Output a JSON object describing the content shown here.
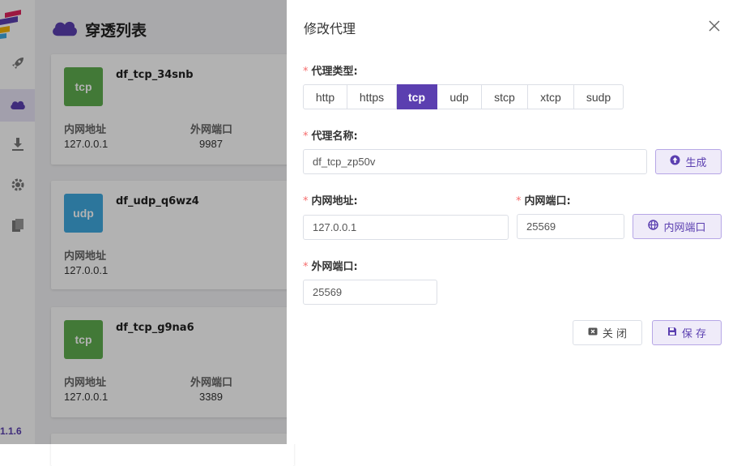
{
  "app": {
    "version": "1.1.6",
    "list_title": "穿透列表",
    "cards": [
      {
        "type": "tcp",
        "name": "df_tcp_34snb",
        "lan_label": "内网地址",
        "lan_value": "127.0.0.1",
        "wan_label": "外网端口",
        "wan_value": "9987"
      },
      {
        "type": "udp",
        "name": "df_udp_q6wz4",
        "lan_label": "内网地址",
        "lan_value": "127.0.0.1"
      },
      {
        "type": "tcp",
        "name": "df_tcp_g9na6",
        "lan_label": "内网地址",
        "lan_value": "127.0.0.1",
        "wan_label": "外网端口",
        "wan_value": "3389"
      }
    ]
  },
  "dialog": {
    "title": "修改代理",
    "required_mark": "*",
    "type_label": "代理类型:",
    "type_options": [
      "http",
      "https",
      "tcp",
      "udp",
      "stcp",
      "xtcp",
      "sudp"
    ],
    "selected_type": "tcp",
    "name_label": "代理名称:",
    "name_value": "df_tcp_zp50v",
    "generate_label": "生成",
    "local_ip_label": "内网地址:",
    "local_ip_value": "127.0.0.1",
    "local_port_label": "内网端口:",
    "local_port_value": "25569",
    "local_port_button": "内网端口",
    "remote_port_label": "外网端口:",
    "remote_port_value": "25569",
    "close_label": "关 闭",
    "save_label": "保 存"
  },
  "colors": {
    "accent": "#5b3fb0",
    "tcp_badge": "#5fae4f",
    "udp_badge": "#3fa9e0",
    "required": "#f56c6c"
  }
}
